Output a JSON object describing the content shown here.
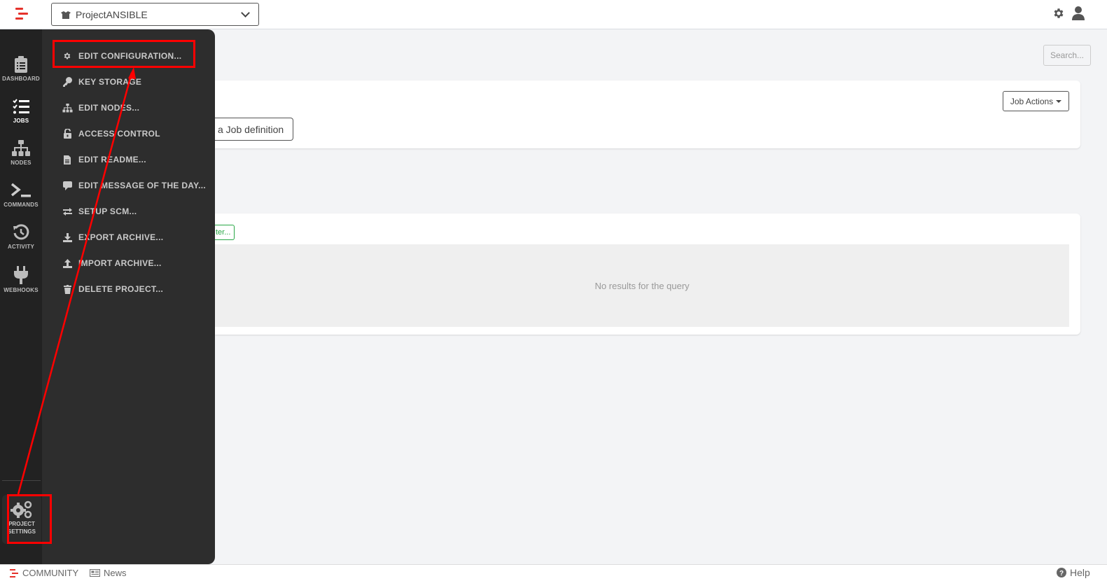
{
  "header": {
    "project_name": "ProjectANSIBLE",
    "settings_icon": "gear-icon",
    "user_icon": "user-icon"
  },
  "leftnav": {
    "items": [
      {
        "label": "DASHBOARD",
        "icon": "clipboard-icon"
      },
      {
        "label": "JOBS",
        "icon": "tasks-icon",
        "active": true
      },
      {
        "label": "NODES",
        "icon": "sitemap-icon"
      },
      {
        "label": "COMMANDS",
        "icon": "terminal-icon"
      },
      {
        "label": "ACTIVITY",
        "icon": "history-icon"
      },
      {
        "label": "WEBHOOKS",
        "icon": "plug-icon"
      }
    ],
    "project_settings": {
      "line1": "PROJECT",
      "line2": "SETTINGS",
      "icon": "gears-icon"
    }
  },
  "settings_menu": {
    "items": [
      {
        "label": "EDIT CONFIGURATION...",
        "icon": "gear-icon"
      },
      {
        "label": "KEY STORAGE",
        "icon": "key-icon"
      },
      {
        "label": "EDIT NODES...",
        "icon": "sitemap-icon"
      },
      {
        "label": "ACCESS CONTROL",
        "icon": "unlock-icon"
      },
      {
        "label": "EDIT README...",
        "icon": "file-icon"
      },
      {
        "label": "EDIT MESSAGE OF THE DAY...",
        "icon": "comment-icon"
      },
      {
        "label": "SETUP SCM...",
        "icon": "exchange-icon"
      },
      {
        "label": "EXPORT ARCHIVE...",
        "icon": "download-icon"
      },
      {
        "label": "IMPORT ARCHIVE...",
        "icon": "upload-icon"
      },
      {
        "label": "DELETE PROJECT...",
        "icon": "trash-icon"
      }
    ]
  },
  "main": {
    "search_placeholder": "Search...",
    "create_job_label": "a Job definition",
    "job_actions_label": "Job Actions",
    "filter_label": "ter...",
    "no_results": "No results for the query"
  },
  "footer": {
    "community": "COMMUNITY",
    "news": "News",
    "help": "Help"
  },
  "annotation": {
    "color": "#ff0000"
  }
}
